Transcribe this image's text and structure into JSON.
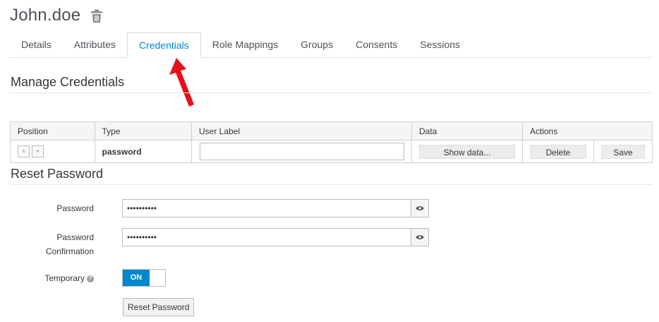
{
  "header": {
    "title": "John.doe",
    "delete_icon": "trash-icon"
  },
  "tabs": [
    {
      "label": "Details"
    },
    {
      "label": "Attributes"
    },
    {
      "label": "Credentials",
      "active": true
    },
    {
      "label": "Role Mappings"
    },
    {
      "label": "Groups"
    },
    {
      "label": "Consents"
    },
    {
      "label": "Sessions"
    }
  ],
  "manage_credentials": {
    "title": "Manage Credentials",
    "columns": [
      "Position",
      "Type",
      "User Label",
      "Data",
      "Actions"
    ],
    "rows": [
      {
        "type": "password",
        "user_label": "",
        "show_data_label": "Show data...",
        "delete_label": "Delete",
        "save_label": "Save"
      }
    ]
  },
  "reset_password": {
    "title": "Reset Password",
    "password_label": "Password",
    "password_value": "••••••••••",
    "confirmation_label_line1": "Password",
    "confirmation_label_line2": "Confirmation",
    "confirmation_value": "••••••••••",
    "temporary_label": "Temporary",
    "temporary_toggle": "ON",
    "reset_button": "Reset Password"
  },
  "colors": {
    "accent": "#0088ce",
    "annotation_arrow": "#e8101b"
  }
}
